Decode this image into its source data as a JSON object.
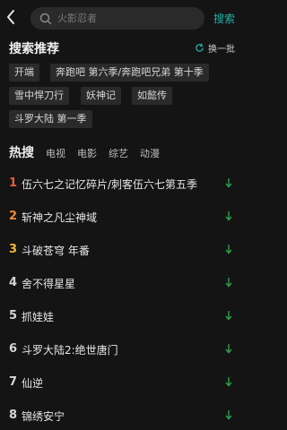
{
  "header": {
    "search_placeholder": "火影忍者",
    "search_button": "搜索"
  },
  "recommend": {
    "title": "搜索推荐",
    "refresh_label": "换一批",
    "chips": [
      "开端",
      "奔跑吧 第六季/奔跑吧兄弟 第十季",
      "雪中悍刀行",
      "妖神记",
      "如懿传",
      "斗罗大陆 第一季"
    ]
  },
  "hot": {
    "tabs": [
      "热搜",
      "电视",
      "电影",
      "综艺",
      "动漫"
    ],
    "items": [
      {
        "rank": "1",
        "title": "伍六七之记忆碎片/刺客伍六七第五季"
      },
      {
        "rank": "2",
        "title": "斩神之凡尘神域"
      },
      {
        "rank": "3",
        "title": "斗破苍穹 年番"
      },
      {
        "rank": "4",
        "title": "舍不得星星"
      },
      {
        "rank": "5",
        "title": "抓娃娃"
      },
      {
        "rank": "6",
        "title": "斗罗大陆2:绝世唐门"
      },
      {
        "rank": "7",
        "title": "仙逆"
      },
      {
        "rank": "8",
        "title": "锦绣安宁"
      }
    ]
  },
  "colors": {
    "accent": "#1fb3a6",
    "trend_down": "#2e9e4a",
    "rank1": "#e85d3f",
    "rank2": "#f08b30",
    "rank3": "#f3b93a"
  }
}
